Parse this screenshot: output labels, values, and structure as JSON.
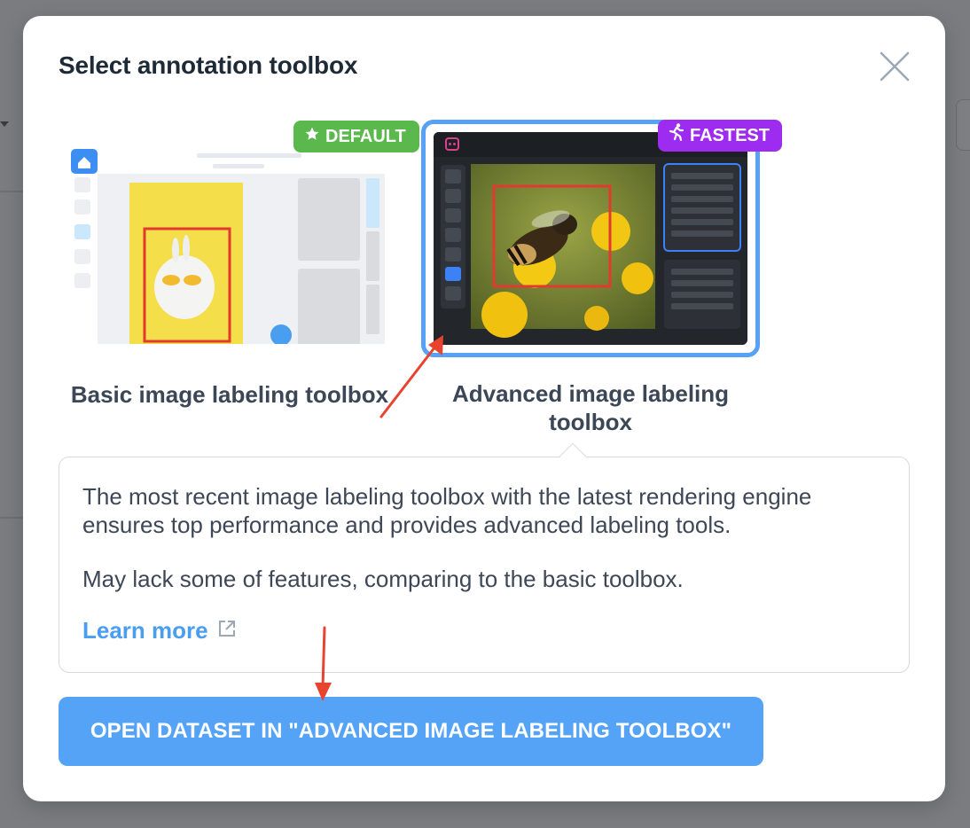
{
  "modal": {
    "title": "Select annotation toolbox",
    "close_icon": "close-icon"
  },
  "options": [
    {
      "label": "Basic image labeling toolbox",
      "badge": {
        "text": "DEFAULT",
        "icon": "star-icon",
        "color": "#5bb84d"
      },
      "selected": false
    },
    {
      "label": "Advanced image labeling toolbox",
      "badge": {
        "text": "FASTEST",
        "icon": "running-person-icon",
        "color": "#9d2cf0"
      },
      "selected": true
    }
  ],
  "description": {
    "paragraph1": "The most recent image labeling toolbox with the latest rendering engine ensures top performance and provides advanced labeling tools.",
    "paragraph2": "May lack some of features, comparing to the basic toolbox.",
    "learn_more": "Learn more",
    "learn_more_icon": "external-link-icon"
  },
  "cta": {
    "label": "OPEN DATASET IN \"ADVANCED IMAGE LABELING TOOLBOX\""
  },
  "colors": {
    "accent": "#55a3f7",
    "selected_border": "#57a2f7",
    "annotation_arrow": "#e8432f"
  }
}
